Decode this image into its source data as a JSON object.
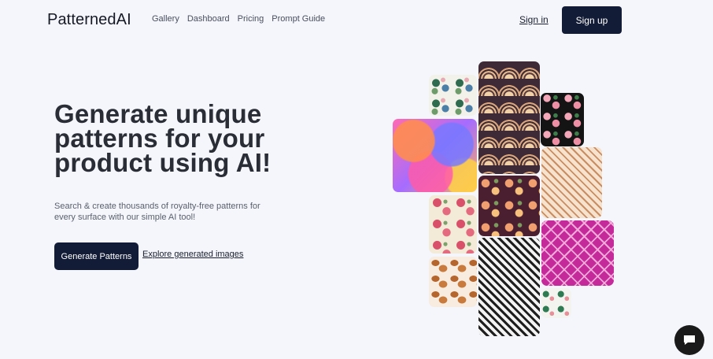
{
  "nav": {
    "logo": "PatternedAI",
    "links": [
      "Gallery",
      "Dashboard",
      "Pricing",
      "Prompt Guide"
    ],
    "sign_in": "Sign in",
    "sign_up": "Sign up"
  },
  "hero": {
    "title": "Generate unique patterns for your product using AI!",
    "subtitle": "Search & create thousands of royalty-free patterns for every surface with our simple AI tool!",
    "cta_primary": "Generate Patterns",
    "cta_secondary": "Explore generated images"
  },
  "gallery": {
    "tiles": [
      "botanical-leaves",
      "art-deco-fan",
      "pink-roses-black",
      "colorful-circles",
      "geometric-diamond-beige",
      "autumn-floral-plum",
      "red-roses-cream",
      "magenta-diamond-lattice",
      "black-white-diamond",
      "pastries-cream",
      "green-botanical-small"
    ]
  },
  "chat": {
    "icon": "chat-bubble-icon"
  }
}
